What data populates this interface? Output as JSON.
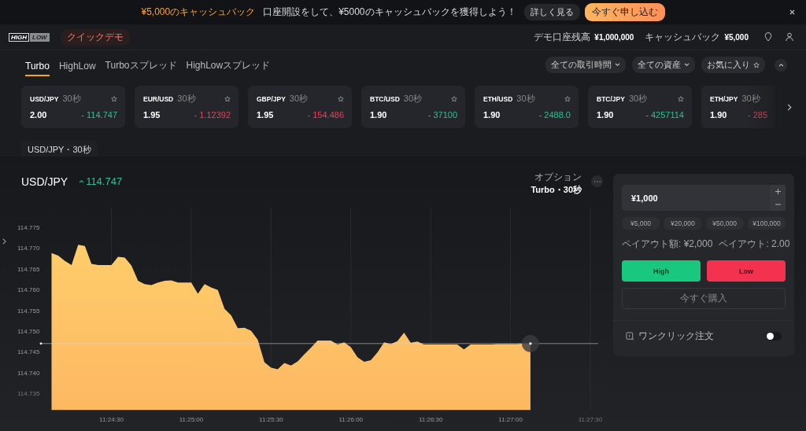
{
  "banner": {
    "highlight": "¥5,000のキャッシュバック",
    "message": "口座開設をして、¥5000のキャッシュバックを獲得しよう！",
    "details_button": "詳しく見る",
    "apply_button": "今すぐ申し込む"
  },
  "header": {
    "logo": {
      "top": "HIGH",
      "bottom": "LOW"
    },
    "demo_badge": "クイックデモ",
    "balance_label": "デモ口座残高",
    "balance": "¥1,000,000",
    "cashback_label": "キャッシュバック",
    "cashback": "¥5,000"
  },
  "tabs": [
    {
      "label": "Turbo",
      "selected": true
    },
    {
      "label": "HighLow",
      "selected": false
    },
    {
      "label": "Turboスプレッド",
      "selected": false
    },
    {
      "label": "HighLowスプレッド",
      "selected": false
    }
  ],
  "filters": [
    {
      "kind": "dropdown",
      "label": "全ての取引時間"
    },
    {
      "kind": "dropdown",
      "label": "全ての資産"
    },
    {
      "kind": "favorite",
      "label": "お気に入り"
    }
  ],
  "assets": [
    {
      "pair": "USD/JPY",
      "duration": "30秒",
      "payout": "2.00",
      "price": "- 114.747",
      "color": "#27c38a"
    },
    {
      "pair": "EUR/USD",
      "duration": "30秒",
      "payout": "1.95",
      "price": "- 1.12392",
      "color": "#ee3f55"
    },
    {
      "pair": "GBP/JPY",
      "duration": "30秒",
      "payout": "1.95",
      "price": "- 154.486",
      "color": "#ee3f55"
    },
    {
      "pair": "BTC/USD",
      "duration": "30秒",
      "payout": "1.90",
      "price": "- 37100",
      "color": "#27c38a"
    },
    {
      "pair": "ETH/USD",
      "duration": "30秒",
      "payout": "1.90",
      "price": "- 2488.0",
      "color": "#27c38a"
    },
    {
      "pair": "BTC/JPY",
      "duration": "30秒",
      "payout": "1.90",
      "price": "- 4257114",
      "color": "#27c38a"
    },
    {
      "pair": "ETH/JPY",
      "duration": "30秒",
      "payout": "1.90",
      "price": "- 285",
      "color": "#c0424f"
    }
  ],
  "chart_tab": "USD/JPY・30秒",
  "chart": {
    "symbol": "USD/JPY",
    "price": "114.747",
    "color": "#27c38a",
    "option_label": "オプション",
    "option_value": "Turbo・30秒",
    "chart_data": {
      "type": "area",
      "categories": [
        null,
        null,
        null,
        null,
        null,
        null,
        null,
        null,
        null,
        "11:24:30",
        null,
        null,
        null,
        null,
        null,
        null,
        null,
        null,
        null,
        null,
        null,
        "11:25:00",
        null,
        null,
        null,
        null,
        null,
        null,
        null,
        null,
        null,
        null,
        null,
        "11:25:30",
        null,
        null,
        null,
        null,
        null,
        null,
        null,
        null,
        null,
        null,
        null,
        "11:26:00",
        null,
        null,
        null,
        null,
        null,
        null,
        null,
        null,
        null,
        null,
        null,
        "11:26:30",
        null,
        null,
        null,
        null,
        null,
        null,
        null,
        null,
        null,
        null,
        null,
        "11:27:00",
        null,
        null,
        null,
        null,
        null,
        null,
        null,
        null,
        null,
        null,
        null,
        "11:27:30"
      ],
      "series": [
        {
          "color": "#fdb862",
          "values": [
            114.7688,
            114.7682,
            114.7669,
            114.7659,
            114.7708,
            114.7705,
            114.7662,
            114.7659,
            114.7659,
            114.7659,
            114.7679,
            114.7677,
            114.7658,
            114.7621,
            114.7613,
            114.7611,
            114.7617,
            114.7621,
            114.7622,
            114.7617,
            114.7617,
            114.7617,
            114.759,
            114.7613,
            114.7605,
            114.7599,
            114.7554,
            114.7538,
            114.7507,
            114.7508,
            114.7501,
            114.7479,
            114.7425,
            114.7412,
            114.7408,
            114.7423,
            114.7417,
            114.7427,
            114.7444,
            114.746,
            114.7477,
            114.7477,
            114.7477,
            114.7468,
            114.7473,
            114.7461,
            114.7437,
            114.7426,
            114.743,
            114.7449,
            114.7473,
            114.7469,
            114.7476,
            114.7496,
            114.7472,
            114.7475,
            114.7468,
            114.7468,
            114.7468,
            114.7468,
            114.7468,
            114.7468,
            114.7456,
            114.7468,
            114.7468,
            114.7468,
            114.7468,
            114.7469,
            114.7469,
            114.7469,
            114.7469,
            114.747,
            114.747,
            null,
            null,
            null,
            null,
            null,
            null,
            null,
            null,
            null
          ]
        }
      ],
      "ylim": [
        114.731,
        114.775
      ],
      "grid": true,
      "ref_lines": [
        {
          "axis": "y",
          "value": 114.747
        }
      ],
      "yticks": [
        114.735,
        {
          "value": 114.74,
          "label": "114.740"
        },
        114.745,
        {
          "value": 114.75,
          "label": "114.750"
        },
        114.755,
        {
          "value": 114.76,
          "label": "114.760"
        },
        114.765,
        {
          "value": 114.77,
          "label": "114.770"
        },
        114.775
      ]
    }
  },
  "trade": {
    "amount": "¥1,000",
    "presets": [
      "¥5,000",
      "¥20,000",
      "¥50,000",
      "¥100,000"
    ],
    "payout_amount": "ペイアウト額: ¥2,000",
    "payout_rate": "ペイアウト: 2.00",
    "high_button": "High",
    "low_button": "Low",
    "buy_button": {
      "label": "今すぐ購入",
      "disabled": true
    },
    "one_click": {
      "label": "ワンクリック注文",
      "on": false
    }
  }
}
